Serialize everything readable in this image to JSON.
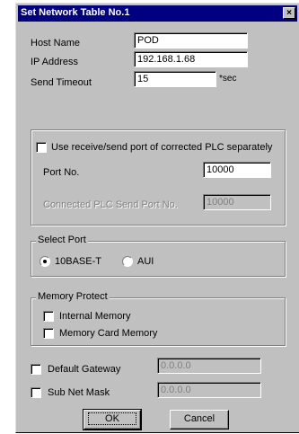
{
  "window": {
    "title": "Set Network Table No.1",
    "close_glyph": "×"
  },
  "fields": {
    "host_name": {
      "label": "Host Name",
      "value": "POD"
    },
    "ip_address": {
      "label": "IP Address",
      "value": "192.168.1.68"
    },
    "send_timeout": {
      "label": "Send Timeout",
      "value": "15",
      "unit": "*sec"
    }
  },
  "port_group": {
    "checkbox_label": "Use receive/send port of corrected PLC separately",
    "checked": false,
    "port_no_label": "Port No.",
    "port_no_value": "10000",
    "send_port_label": "Connected PLC Send Port No.",
    "send_port_value": "10000"
  },
  "select_port": {
    "caption": "Select Port",
    "options": [
      "10BASE-T",
      "AUI"
    ],
    "selected": "10BASE-T"
  },
  "memory_protect": {
    "caption": "Memory Protect",
    "items": [
      {
        "label": "Internal Memory",
        "checked": false
      },
      {
        "label": "Memory Card Memory",
        "checked": false
      }
    ]
  },
  "gateway": {
    "label": "Default Gateway",
    "checked": false,
    "value": "0.0.0.0"
  },
  "subnet": {
    "label": "Sub Net Mask",
    "checked": false,
    "value": "0.0.0.0"
  },
  "buttons": {
    "ok": "OK",
    "cancel": "Cancel"
  },
  "colors": {
    "title_bar": "#000080",
    "face": "#c0c0c0",
    "disabled_text": "#808080"
  }
}
